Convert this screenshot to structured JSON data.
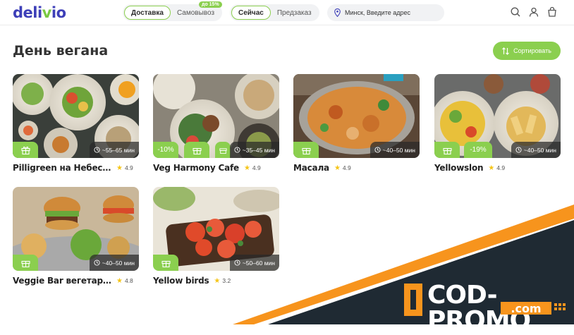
{
  "header": {
    "logo_prefix": "deli",
    "logo_v": "v",
    "logo_suffix": "io",
    "delivery_mode": [
      "Доставка",
      "Самовывоз"
    ],
    "pickup_badge": "до 15%",
    "time_mode": [
      "Сейчас",
      "Предзаказ"
    ],
    "address_placeholder": "Минск, Введите адрес"
  },
  "page": {
    "title": "День вегана",
    "sort_label": "Сортировать"
  },
  "restaurants": [
    {
      "name": "Pilligreen на Небесной",
      "rating": "4.9",
      "time": "~55–65 мин",
      "discount": ""
    },
    {
      "name": "Veg Harmony Cafe",
      "rating": "4.9",
      "time": "~35–45 мин",
      "discount": "-10%"
    },
    {
      "name": "Масала",
      "rating": "4.9",
      "time": "~40–50 мин",
      "discount": ""
    },
    {
      "name": "Yellowslon",
      "rating": "4.9",
      "time": "~40–50 мин",
      "discount": "-19%"
    },
    {
      "name": "Veggie Bar вегетарианское кафе",
      "rating": "4.8",
      "time": "~40–50 мин",
      "discount": ""
    },
    {
      "name": "Yellow birds",
      "rating": "3.2",
      "time": "~50–60 мин",
      "discount": ""
    }
  ],
  "watermark": {
    "main": "COD-PROMO",
    "sub": ".com"
  },
  "colors": {
    "brand": "#3d3fb8",
    "accent": "#8bcf4f",
    "promo_orange": "#f7941d",
    "promo_dark": "#1f2a33"
  },
  "icons": [
    "map-pin-icon",
    "search-icon",
    "user-icon",
    "cart-icon",
    "sort-icon",
    "gift-icon",
    "clock-icon",
    "star-icon"
  ]
}
